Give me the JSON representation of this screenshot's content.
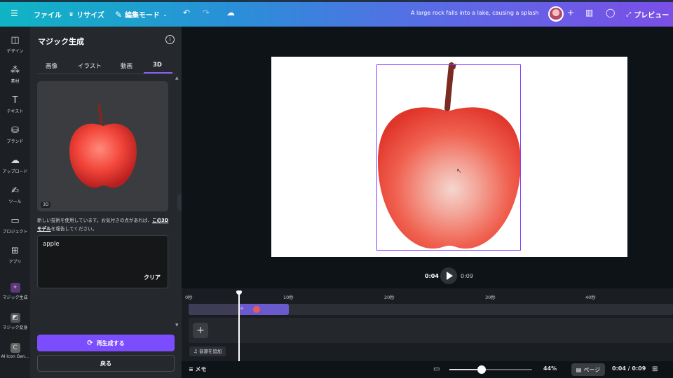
{
  "topbar": {
    "menu_icon": "hamburger-icon",
    "file_label": "ファイル",
    "resize_label": "リサイズ",
    "edit_mode_label": "編集モード",
    "title": "A large rock falls into a lake, causing a splash",
    "preview_label": "プレビュー",
    "gradient_start": "#0fb5c4",
    "gradient_end": "#7a4fe6"
  },
  "rail": {
    "items": [
      {
        "label": "デザイン",
        "icon": "layout-icon"
      },
      {
        "label": "素材",
        "icon": "elements-icon"
      },
      {
        "label": "テキスト",
        "icon": "text-icon"
      },
      {
        "label": "ブランド",
        "icon": "brand-icon"
      },
      {
        "label": "アップロード",
        "icon": "upload-icon"
      },
      {
        "label": "ツール",
        "icon": "draw-icon"
      },
      {
        "label": "プロジェクト",
        "icon": "folder-icon"
      },
      {
        "label": "アプリ",
        "icon": "apps-icon"
      },
      {
        "label": "マジック生成",
        "icon": "magic-media-icon"
      },
      {
        "label": "マジック変身",
        "icon": "magic-morph-icon"
      },
      {
        "label": "AI Icon Gen...",
        "icon": "ai-icon-gen-icon"
      }
    ]
  },
  "panel": {
    "title": "マジック生成",
    "tabs": [
      "画像",
      "イラスト",
      "動画",
      "3D"
    ],
    "active_tab": "3D",
    "badge": "3D",
    "notice": "新しい技術を使用しています。お気付きの点があれば、",
    "notice_link": "この3Dモデル",
    "notice_tail": "を報告してください。",
    "prompt_value": "apple",
    "clear_label": "クリア",
    "regenerate_label": "再生成する",
    "back_label": "戻る",
    "accent": "#7c4dff"
  },
  "player": {
    "current_time": "0:04",
    "total_time": "0:09"
  },
  "timeline": {
    "ticks": [
      "0秒",
      "10秒",
      "20秒",
      "30秒",
      "40秒"
    ],
    "add_audio_label": "音源を追加",
    "playhead_time_seconds": 4
  },
  "bottombar": {
    "notes_label": "メモ",
    "zoom": "44%",
    "page_label": "ページ",
    "time": "0:04 / 0:09"
  }
}
